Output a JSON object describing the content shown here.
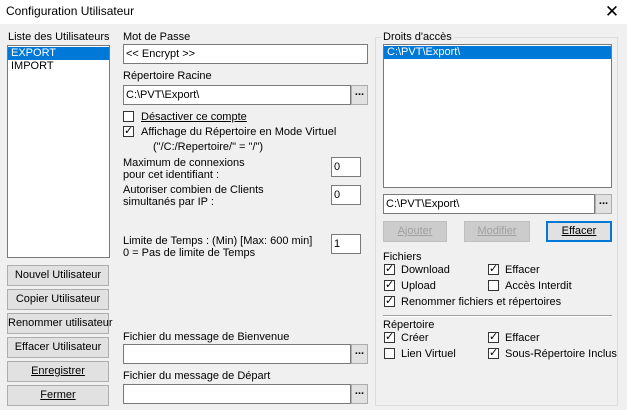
{
  "window": {
    "title": "Configuration Utilisateur",
    "close_glyph": "✕"
  },
  "users": {
    "label": "Liste des Utilisateurs",
    "items": [
      "EXPORT",
      "IMPORT"
    ],
    "selected": 0
  },
  "password": {
    "label": "Mot de Passe",
    "value": "<< Encrypt >>"
  },
  "root_dir": {
    "label": "Répertoire Racine",
    "value": "C:\\PVT\\Export\\"
  },
  "browse_glyph": "...",
  "options": {
    "disable": {
      "label": "Désactiver ce compte",
      "checked": false
    },
    "virtual": {
      "label": "Affichage du Répertoire en Mode Virtuel",
      "checked": true,
      "hint": "(\"/C:/Repertoire/\" = \"/\")"
    }
  },
  "max_conn": {
    "label_line1": "Maximum de connexions",
    "label_line2": "pour cet identifiant :",
    "value": "0"
  },
  "max_clients": {
    "label_line1": "Autoriser combien de Clients",
    "label_line2": "simultanés par IP :",
    "value": "0"
  },
  "time_limit": {
    "label_line1": "Limite de Temps : (Min) [Max: 600 min]",
    "label_line2": "0 = Pas de limite de Temps",
    "value": "1"
  },
  "buttons": {
    "new_user": "Nouvel Utilisateur",
    "copy_user": "Copier Utilisateur",
    "rename_user": "Renommer utilisateur",
    "delete_user": "Effacer Utilisateur",
    "save": "Enregistrer",
    "close": "Fermer"
  },
  "welcome": {
    "label": "Fichier du message de Bienvenue",
    "value": ""
  },
  "departure": {
    "label": "Fichier du message de Départ",
    "value": ""
  },
  "access": {
    "group_label": "Droits d'accès",
    "items": [
      "C:\\PVT\\Export\\"
    ],
    "path_value": "C:\\PVT\\Export\\",
    "add": "Ajouter",
    "modify": "Modifier",
    "delete": "Effacer"
  },
  "files": {
    "label": "Fichiers",
    "download": {
      "label": "Download",
      "checked": true
    },
    "delete": {
      "label": "Effacer",
      "checked": true
    },
    "upload": {
      "label": "Upload",
      "checked": true
    },
    "access_denied": {
      "label": "Accès Interdit",
      "checked": false
    },
    "rename": {
      "label": "Renommer fichiers et répertoires",
      "checked": true
    }
  },
  "dirs": {
    "label": "Répertoire",
    "create": {
      "label": "Créer",
      "checked": true
    },
    "delete": {
      "label": "Effacer",
      "checked": true
    },
    "virtual_link": {
      "label": "Lien Virtuel",
      "checked": false
    },
    "subdirs": {
      "label": "Sous-Répertoire Inclus",
      "checked": true
    }
  }
}
